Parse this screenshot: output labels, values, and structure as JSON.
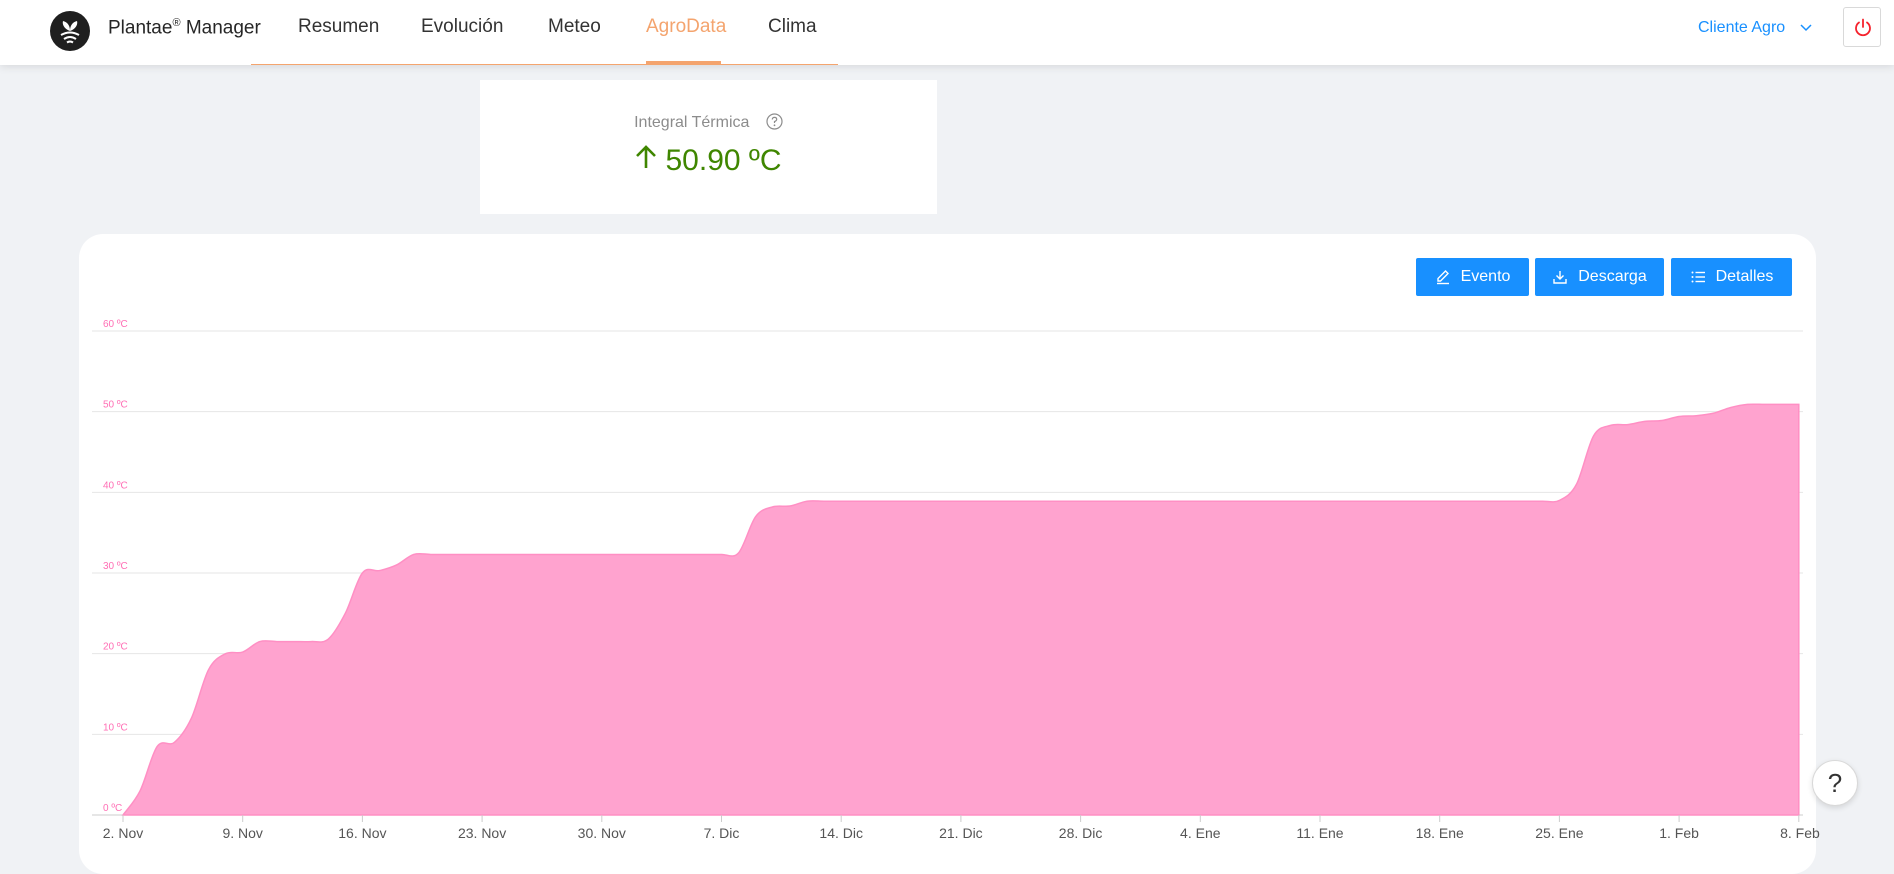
{
  "header": {
    "brand_name": "Plantae",
    "brand_reg": "®",
    "brand_suffix": " Manager",
    "nav": [
      {
        "label": "Resumen"
      },
      {
        "label": "Evolución"
      },
      {
        "label": "Meteo"
      },
      {
        "label": "AgroData",
        "active": true
      },
      {
        "label": "Clima"
      }
    ],
    "user_label": "Cliente Agro",
    "accent_color": "#f4a46e",
    "link_color": "#1890ff",
    "power_color": "#f5222d"
  },
  "stat": {
    "title": "Integral Térmica",
    "value": "50.90 ºC",
    "value_color": "#3f8600"
  },
  "toolbar": {
    "event_label": "Evento",
    "download_label": "Descarga",
    "details_label": "Detalles"
  },
  "help_label": "?",
  "chart_data": {
    "type": "area",
    "color": "#ffa3cf",
    "ylim": [
      0,
      60
    ],
    "yticks": [
      "0 ºC",
      "10 ºC",
      "20 ºC",
      "30 ºC",
      "40 ºC",
      "50 ºC",
      "60 ºC"
    ],
    "xticks": [
      "2. Nov",
      "9. Nov",
      "16. Nov",
      "23. Nov",
      "30. Nov",
      "7. Dic",
      "14. Dic",
      "21. Dic",
      "28. Dic",
      "4. Ene",
      "11. Ene",
      "18. Ene",
      "25. Ene",
      "1. Feb",
      "8. Feb"
    ],
    "x_day": [
      0,
      1,
      2,
      3,
      4,
      5,
      6,
      7,
      8,
      9,
      10,
      11,
      12,
      13,
      14,
      15,
      16,
      17,
      18,
      19,
      20,
      21,
      22,
      23,
      24,
      25,
      26,
      27,
      28,
      29,
      30,
      31,
      32,
      33,
      34,
      35,
      36,
      37,
      38,
      39,
      40,
      41,
      42,
      43,
      44,
      45,
      46,
      47,
      48,
      49,
      50,
      51,
      52,
      53,
      54,
      55,
      56,
      57,
      58,
      59,
      60,
      61,
      62,
      63,
      64,
      65,
      66,
      67,
      68,
      69,
      70,
      71,
      72,
      73,
      74,
      75,
      76,
      77,
      78,
      79,
      80,
      81,
      82,
      83,
      84,
      85,
      86,
      87,
      88,
      89,
      90,
      91,
      92,
      93,
      94,
      95,
      96,
      97,
      98
    ],
    "values": [
      0,
      3,
      8.5,
      9,
      12,
      18,
      20,
      20.2,
      21.5,
      21.5,
      21.5,
      21.5,
      21.8,
      25,
      30,
      30.3,
      31,
      32.3,
      32.3,
      32.3,
      32.3,
      32.3,
      32.3,
      32.3,
      32.3,
      32.3,
      32.3,
      32.3,
      32.3,
      32.3,
      32.3,
      32.3,
      32.3,
      32.3,
      32.3,
      32.3,
      32.5,
      37,
      38.2,
      38.3,
      38.9,
      38.9,
      38.9,
      38.9,
      38.9,
      38.9,
      38.9,
      38.9,
      38.9,
      38.9,
      38.9,
      38.9,
      38.9,
      38.9,
      38.9,
      38.9,
      38.9,
      38.9,
      38.9,
      38.9,
      38.9,
      38.9,
      38.9,
      38.9,
      38.9,
      38.9,
      38.9,
      38.9,
      38.9,
      38.9,
      38.9,
      38.9,
      38.9,
      38.9,
      38.9,
      38.9,
      38.9,
      38.9,
      38.9,
      38.9,
      38.9,
      38.9,
      38.9,
      38.9,
      39,
      41,
      47,
      48.3,
      48.4,
      48.8,
      48.9,
      49.4,
      49.5,
      49.8,
      50.5,
      50.9,
      50.9,
      50.9,
      50.9
    ]
  }
}
